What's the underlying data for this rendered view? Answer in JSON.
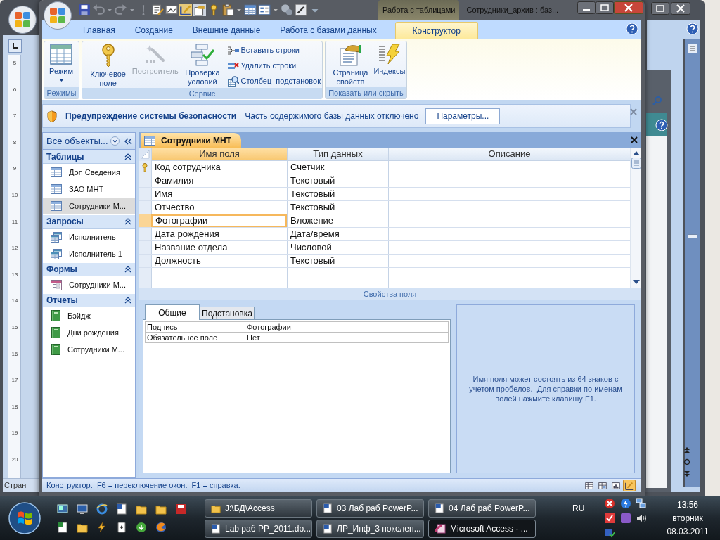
{
  "background_window_left": {
    "ruler_labels": [
      "5",
      "6",
      "7",
      "8",
      "9",
      "10",
      "11",
      "12",
      "13",
      "14",
      "15",
      "16",
      "17",
      "18",
      "19",
      "20"
    ],
    "status_text": "Стран"
  },
  "window": {
    "contextual_tab_group": "Работа с таблицами",
    "title": "Сотрудники_архив : баз..."
  },
  "ribbon_tabs": [
    {
      "label": "Главная",
      "selected": false
    },
    {
      "label": "Создание",
      "selected": false
    },
    {
      "label": "Внешние данные",
      "selected": false
    },
    {
      "label": "Работа с базами данных",
      "selected": false
    },
    {
      "label": "Конструктор",
      "selected": true
    }
  ],
  "ribbon_groups": [
    {
      "label": "Режимы",
      "buttons": [
        {
          "kind": "large",
          "label": "Режим",
          "dropdown": true,
          "disabled": false
        }
      ]
    },
    {
      "label": "Сервис",
      "buttons": [
        {
          "kind": "large",
          "label": "Ключевое поле",
          "dropdown": false,
          "disabled": false
        },
        {
          "kind": "large",
          "label": "Построитель",
          "dropdown": false,
          "disabled": true
        },
        {
          "kind": "large",
          "label": "Проверка условий",
          "dropdown": false,
          "disabled": false
        },
        {
          "kind": "small",
          "label": "Вставить строки",
          "dropdown": false,
          "disabled": false
        },
        {
          "kind": "small",
          "label": "Удалить строки",
          "dropdown": false,
          "disabled": false
        },
        {
          "kind": "small",
          "label": "Столбец  подстановок",
          "dropdown": false,
          "disabled": false
        }
      ]
    },
    {
      "label": "Показать или скрыть",
      "buttons": [
        {
          "kind": "large",
          "label": "Страница свойств",
          "dropdown": false,
          "disabled": false
        },
        {
          "kind": "large",
          "label": "Индексы",
          "dropdown": false,
          "disabled": false
        }
      ]
    }
  ],
  "security_bar": {
    "title": "Предупреждение системы безопасности",
    "message": "Часть содержимого базы данных отключено",
    "button": "Параметры..."
  },
  "navigation": {
    "header": "Все объекты...",
    "groups": [
      {
        "label": "Таблицы",
        "expanded": true,
        "items": [
          {
            "label": "Доп Сведения",
            "selected": false
          },
          {
            "label": "ЗАО МНТ",
            "selected": false
          },
          {
            "label": "Сотрудники М...",
            "selected": true
          }
        ]
      },
      {
        "label": "Запросы",
        "expanded": true,
        "items": [
          {
            "label": "Исполнитель",
            "selected": false
          },
          {
            "label": "Исполнитель 1",
            "selected": false
          }
        ]
      },
      {
        "label": "Формы",
        "expanded": true,
        "items": [
          {
            "label": "Сотрудники М...",
            "selected": false
          }
        ]
      },
      {
        "label": "Отчеты",
        "expanded": true,
        "items": [
          {
            "label": "Бэйдж",
            "selected": false
          },
          {
            "label": "Дни рождения",
            "selected": false
          },
          {
            "label": "Сотрудники М...",
            "selected": false
          }
        ]
      }
    ]
  },
  "document_tab": {
    "label": "Сотрудники МНТ"
  },
  "table": {
    "columns": [
      "Имя поля",
      "Тип данных",
      "Описание"
    ],
    "rows": [
      {
        "field": "Код сотрудника",
        "type": "Счетчик",
        "primary_key": true,
        "selected": false
      },
      {
        "field": "Фамилия",
        "type": "Текстовый",
        "primary_key": false,
        "selected": false
      },
      {
        "field": "Имя",
        "type": "Текстовый",
        "primary_key": false,
        "selected": false
      },
      {
        "field": "Отчество",
        "type": "Текстовый",
        "primary_key": false,
        "selected": false
      },
      {
        "field": "Фотографии",
        "type": "Вложение",
        "primary_key": false,
        "selected": true
      },
      {
        "field": "Дата рождения",
        "type": "Дата/время",
        "primary_key": false,
        "selected": false
      },
      {
        "field": "Название отдела",
        "type": "Числовой",
        "primary_key": false,
        "selected": false
      },
      {
        "field": "Должность",
        "type": "Текстовый",
        "primary_key": false,
        "selected": false
      }
    ]
  },
  "field_properties": {
    "title": "Свойства поля",
    "tabs": [
      {
        "label": "Общие",
        "selected": true
      },
      {
        "label": "Подстановка",
        "selected": false
      }
    ],
    "rows": [
      {
        "label": "Подпись",
        "value": "Фотографии"
      },
      {
        "label": "Обязательное поле",
        "value": "Нет"
      }
    ],
    "help": "Имя поля может состоять из 64 знаков с учетом пробелов.  Для справки по именам полей нажмите клавишу F1."
  },
  "status_bar": {
    "text": "Конструктор.  F6 = переключение окон.  F1 = справка.",
    "view_buttons": [
      {
        "selected": false
      },
      {
        "selected": false
      },
      {
        "selected": false
      },
      {
        "selected": true
      }
    ]
  },
  "taskbar": {
    "tasks": [
      {
        "label": "J:\\БД\\Access",
        "kind": "folder",
        "selected": false
      },
      {
        "label": "03 Лаб раб PowerP...",
        "kind": "word",
        "selected": false
      },
      {
        "label": "04 Лаб раб PowerP...",
        "kind": "word",
        "selected": false
      },
      {
        "label": "Lab раб PP_2011.do...",
        "kind": "word",
        "selected": false
      },
      {
        "label": "ЛР_Инф_3 поколен...",
        "kind": "word",
        "selected": false
      },
      {
        "label": "Microsoft Access - ...",
        "kind": "access",
        "selected": true
      }
    ],
    "language": "RU",
    "time": "13:56",
    "day": "вторник",
    "date": "08.03.2011"
  }
}
